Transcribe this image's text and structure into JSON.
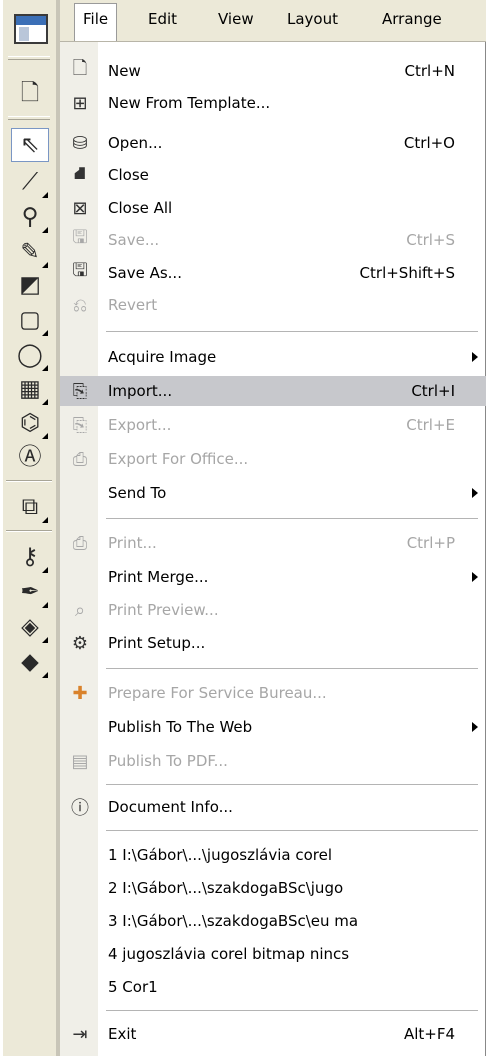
{
  "menubar": {
    "items": [
      "File",
      "Edit",
      "View",
      "Layout",
      "Arrange"
    ]
  },
  "toolbar": {
    "tools": [
      "new-doc-icon",
      "pick-tool-icon",
      "shape-tool-icon",
      "zoom-tool-icon",
      "freehand-tool-icon",
      "smart-fill-icon",
      "rectangle-tool-icon",
      "ellipse-tool-icon",
      "graph-paper-icon",
      "basic-shapes-icon",
      "text-tool-icon",
      "interactive-blend-icon",
      "eyedropper-icon",
      "outline-pen-icon",
      "fill-tool-icon",
      "interactive-fill-icon"
    ]
  },
  "file_menu": {
    "new": {
      "label": "New",
      "shortcut": "Ctrl+N"
    },
    "new_from_template": {
      "label": "New From Template..."
    },
    "open": {
      "label": "Open...",
      "shortcut": "Ctrl+O"
    },
    "close": {
      "label": "Close"
    },
    "close_all": {
      "label": "Close All"
    },
    "save": {
      "label": "Save...",
      "shortcut": "Ctrl+S"
    },
    "save_as": {
      "label": "Save As...",
      "shortcut": "Ctrl+Shift+S"
    },
    "revert": {
      "label": "Revert"
    },
    "acquire_image": {
      "label": "Acquire Image"
    },
    "import": {
      "label": "Import...",
      "shortcut": "Ctrl+I"
    },
    "export": {
      "label": "Export...",
      "shortcut": "Ctrl+E"
    },
    "export_for_office": {
      "label": "Export For Office..."
    },
    "send_to": {
      "label": "Send To"
    },
    "print": {
      "label": "Print...",
      "shortcut": "Ctrl+P"
    },
    "print_merge": {
      "label": "Print Merge..."
    },
    "print_preview": {
      "label": "Print Preview..."
    },
    "print_setup": {
      "label": "Print Setup..."
    },
    "prepare_service_bureau": {
      "label": "Prepare For Service Bureau..."
    },
    "publish_web": {
      "label": "Publish To The Web"
    },
    "publish_pdf": {
      "label": "Publish To PDF..."
    },
    "document_info": {
      "label": "Document Info..."
    },
    "recent": [
      "1 I:\\Gábor\\...\\jugoszlávia corel",
      "2 I:\\Gábor\\...\\szakdogaBSc\\jugo",
      "3 I:\\Gábor\\...\\szakdogaBSc\\eu ma",
      "4 jugoszlávia corel bitmap nincs",
      "5 Cor1"
    ],
    "exit": {
      "label": "Exit",
      "shortcut": "Alt+F4"
    }
  }
}
